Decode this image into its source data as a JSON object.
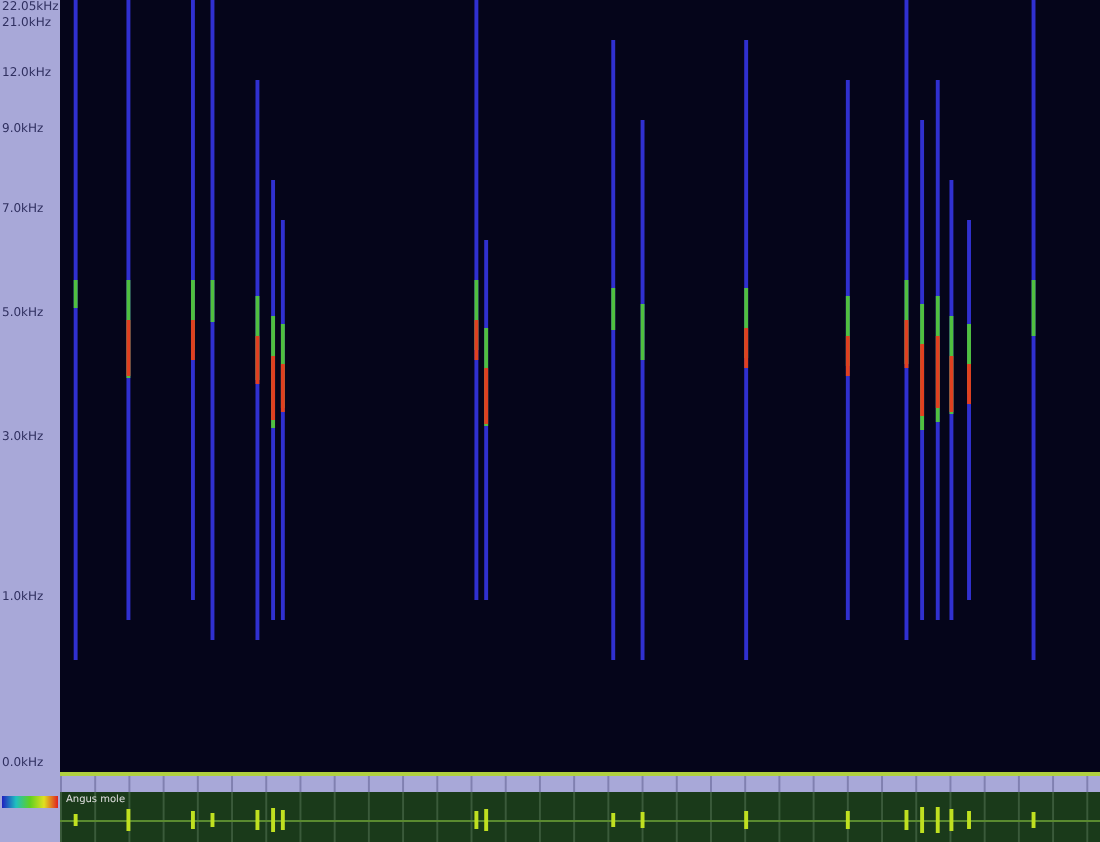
{
  "frequency_axis": {
    "labels": [
      "22.05kHz",
      "21.0kHz",
      "12.0kHz",
      "9.0kHz",
      "7.0kHz",
      "5.0kHz",
      "3.0kHz",
      "1.0kHz",
      "0.0kHz"
    ]
  },
  "track": {
    "name": "Angus mole"
  }
}
